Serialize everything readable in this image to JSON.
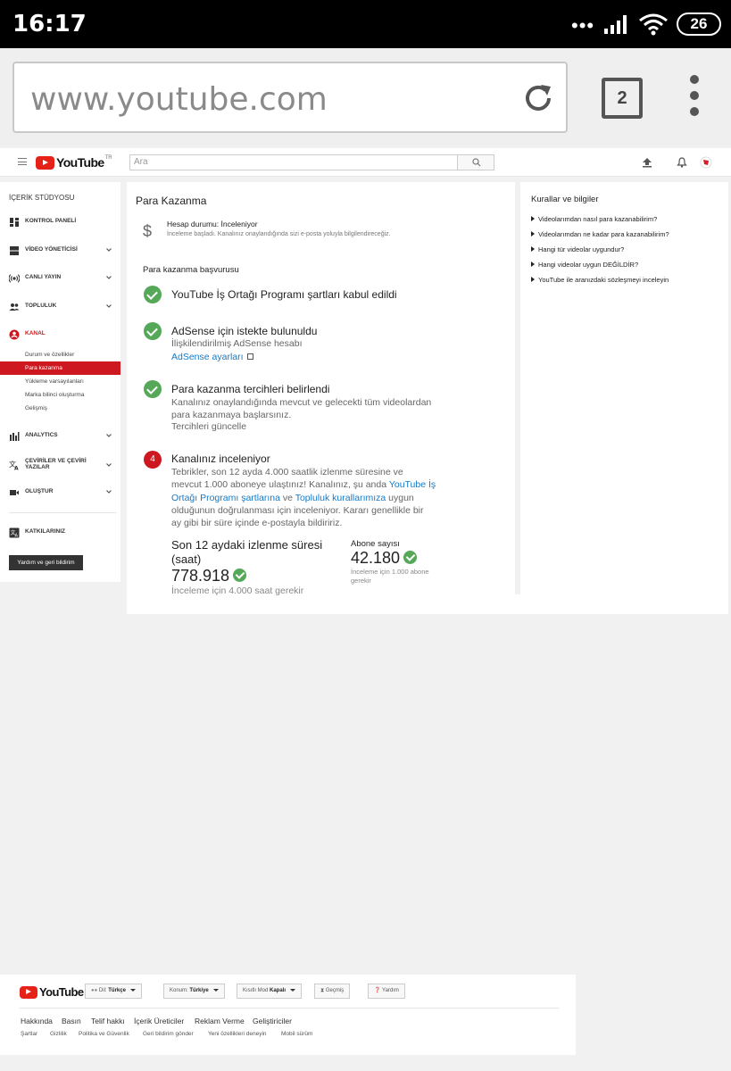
{
  "status_bar": {
    "time": "16:17",
    "battery": "26"
  },
  "browser": {
    "url": "www.youtube.com",
    "tab_count": "2"
  },
  "yt_header": {
    "logo_text": "YouTube",
    "region": "TR",
    "search_placeholder": "Ara"
  },
  "sidebar": {
    "heading": "İÇERİK STÜDYOSU",
    "items": [
      {
        "label": "KONTROL PANELİ",
        "icon": "dashboard-icon"
      },
      {
        "label": "VİDEO YÖNETİCİSİ",
        "icon": "video-manager-icon"
      },
      {
        "label": "CANLI YAYIN",
        "icon": "live-icon"
      },
      {
        "label": "TOPLULUK",
        "icon": "people-icon"
      },
      {
        "label": "KANAL",
        "icon": "channel-icon"
      },
      {
        "label": "ANALYTICS",
        "icon": "analytics-icon"
      },
      {
        "label": "ÇEVİRİLER VE ÇEVİRİ YAZILAR",
        "icon": "translate-icon"
      },
      {
        "label": "OLUŞTUR",
        "icon": "create-icon"
      },
      {
        "label": "KATKILARINIZ",
        "icon": "contributions-icon"
      }
    ],
    "kanal_sub": [
      "Durum ve özellikler",
      "Para kazanma",
      "Yükleme varsayılanları",
      "Marka bilinci oluşturma",
      "Gelişmiş"
    ],
    "feedback": "Yardım ve geri bildirim"
  },
  "main": {
    "title": "Para Kazanma",
    "account_status": "Hesap durumu: İnceleniyor",
    "account_desc": "İnceleme başladı. Kanalınız onaylandığında sizi e-posta yoluyla bilgilendireceğiz.",
    "section": "Para kazanma başvurusu",
    "step1_title": "YouTube İş Ortağı Programı şartları kabul edildi",
    "step2_title": "AdSense için istekte bulunuldu",
    "step2_link1": "İlişkilendirilmiş AdSense hesabı",
    "step2_link2": "AdSense ayarları",
    "step3_title": "Para kazanma tercihleri belirlendi",
    "step3_text1": "Kanalınız onaylandığında mevcut ve gelecekti tüm videolardan",
    "step3_text2": "para kazanmaya başlarsınız.",
    "step3_link": "Tercihleri güncelle",
    "step4_num": "4",
    "step4_title": "Kanalınız inceleniyor",
    "step4_l1": "Tebrikler, son 12 ayda 4.000 saatlik izlenme süresine ve",
    "step4_l2a": "mevcut 1.000 aboneye ulaştınız! Kanalınız, şu anda ",
    "step4_l2b": "YouTube İş",
    "step4_l3a": "Ortağı Programı şartlarına",
    "step4_l3b": " ve ",
    "step4_l3c": "Topluluk kurallarımıza",
    "step4_l3d": " uygun",
    "step4_l4": "olduğunun doğrulanması için inceleniyor. Kararı genellikle bir",
    "step4_l5": "ay gibi bir süre içinde e-postayla bildiririz.",
    "watch_title": "Son 12 aydaki izlenme süresi (saat)",
    "watch_value": "778.918",
    "watch_note": "İnceleme için 4.000 saat gerekir",
    "sub_title": "Abone sayısı",
    "sub_value": "42.180",
    "sub_note": "İnceleme için 1.000 abone gerekir"
  },
  "right": {
    "title": "Kurallar ve bilgiler",
    "items": [
      "Videolarımdan nasıl para kazanabilirim?",
      "Videolarımdan ne kadar para kazanabilirim?",
      "Hangi tür videolar uygundur?",
      "Hangi videolar uygun DEĞİLDİR?",
      "YouTube ile aranızdaki sözleşmeyi inceleyin"
    ]
  },
  "footer": {
    "logo_text": "YouTube",
    "lang_prefix": "Dil:",
    "lang_value": "Türkçe",
    "loc_prefix": "Konum:",
    "loc_value": "Türkiye",
    "restrict_prefix": "Kısıtlı Mod",
    "restrict_value": "Kapalı",
    "history": "Geçmiş",
    "help": "Yardım",
    "links1": [
      "Hakkında",
      "Basın",
      "Telif hakkı",
      "İçerik Üreticiler",
      "Reklam Verme",
      "Geliştiriciler"
    ],
    "links2": [
      "Şartlar",
      "Gizlilik",
      "Politika ve Güvenlik",
      "Geri bildirim gönder",
      "Yeni özellikleri deneyin",
      "Mobil sürüm"
    ]
  }
}
